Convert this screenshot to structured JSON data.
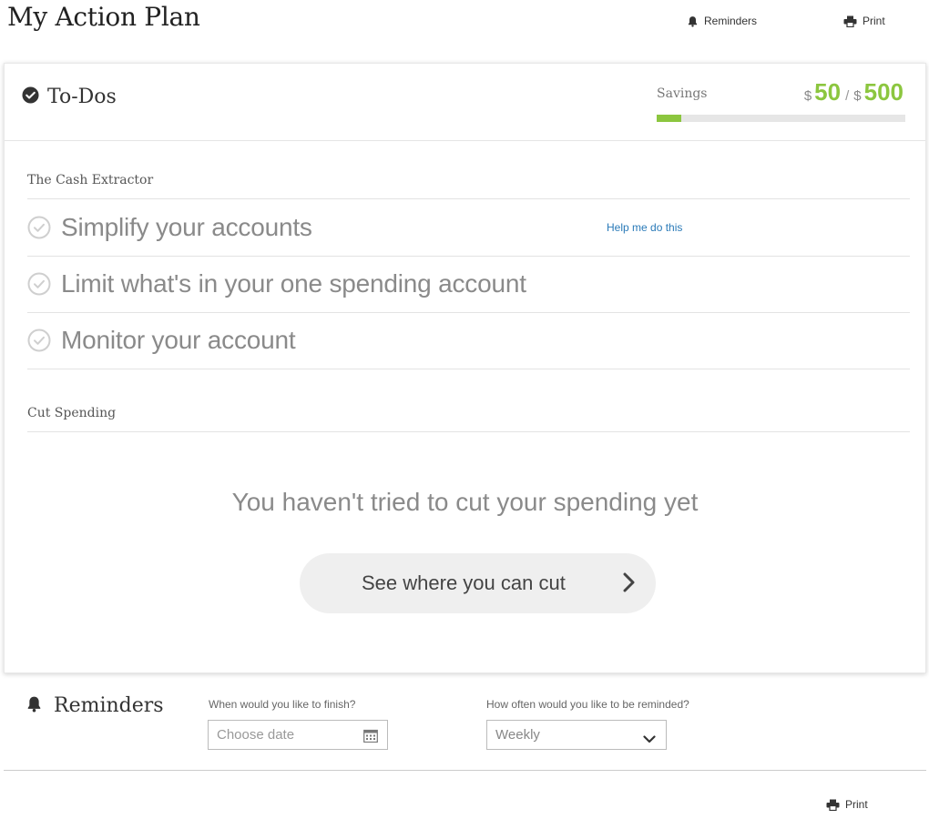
{
  "page": {
    "title": "My Action Plan"
  },
  "top_links": {
    "reminders": "Reminders",
    "print": "Print"
  },
  "todos": {
    "title": "To-Dos",
    "savings": {
      "label": "Savings",
      "currency": "$",
      "current": "50",
      "goal": "500",
      "separator": "/",
      "progress_fraction": 0.1,
      "accent_color": "#8cc63f"
    }
  },
  "sections": [
    {
      "title": "The Cash Extractor",
      "items": [
        {
          "label": "Simplify your accounts",
          "help": "Help me do this"
        },
        {
          "label": "Limit what's in your one spending account"
        },
        {
          "label": "Monitor your account"
        }
      ]
    },
    {
      "title": "Cut Spending",
      "empty_message": "You haven't tried to cut your spending yet",
      "button_label": "See where you can cut"
    }
  ],
  "reminders": {
    "title": "Reminders",
    "finish_label": "When would you like to finish?",
    "finish_placeholder": "Choose date",
    "frequency_label": "How often would you like to be reminded?",
    "frequency_value": "Weekly"
  },
  "footer": {
    "print": "Print"
  },
  "icons": {
    "todos": "check-circle-icon",
    "item_check": "check-circle-outline-icon",
    "bell": "bell-icon",
    "print": "printer-icon",
    "calendar": "calendar-icon",
    "arrow": "chevron-right-icon",
    "dropdown": "chevron-down-icon"
  }
}
